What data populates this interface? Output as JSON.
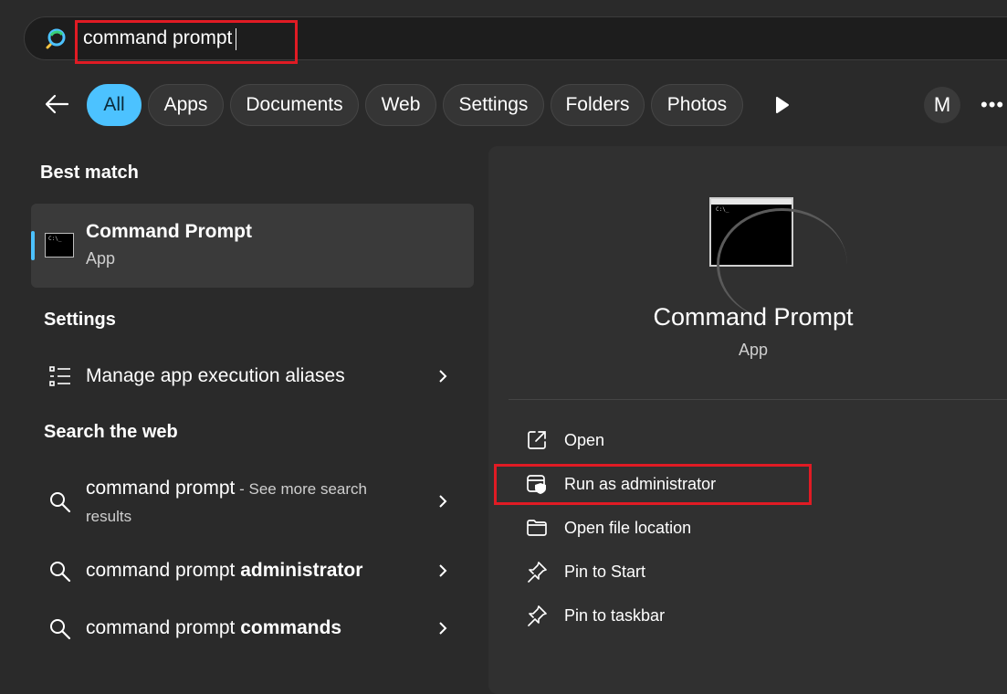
{
  "search": {
    "query": "command prompt"
  },
  "filters": [
    "All",
    "Apps",
    "Documents",
    "Web",
    "Settings",
    "Folders",
    "Photos"
  ],
  "avatar_letter": "M",
  "more_label": "•••",
  "best_match": {
    "header": "Best match",
    "title": "Command Prompt",
    "subtitle": "App",
    "icon_text": "C:\\_"
  },
  "settings": {
    "header": "Settings",
    "item": "Manage app execution aliases"
  },
  "web": {
    "header": "Search the web",
    "items": [
      {
        "prefix": "command prompt",
        "bold": "",
        "suffix": " - See more search",
        "suffix2": "results"
      },
      {
        "prefix": "command prompt ",
        "bold": "administrator"
      },
      {
        "prefix": "command prompt ",
        "bold": "commands"
      }
    ]
  },
  "panel": {
    "title": "Command Prompt",
    "subtitle": "App",
    "icon_text": "C:\\_",
    "actions": [
      "Open",
      "Run as administrator",
      "Open file location",
      "Pin to Start",
      "Pin to taskbar"
    ]
  },
  "colors": {
    "accent": "#4cc2ff",
    "highlight_box": "#e01b24",
    "background": "#2a2a2a"
  }
}
